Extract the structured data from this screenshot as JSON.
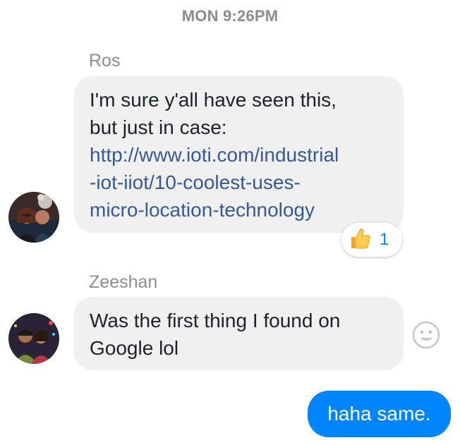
{
  "thread": {
    "timestamp": "MON 9:26PM"
  },
  "messages": [
    {
      "sender": "Ros",
      "text_lines": [
        "I'm sure y'all have seen this,",
        "but just in case:"
      ],
      "link_lines": [
        "http://www.ioti.com/industrial",
        "-iot-iiot/10-coolest-uses-",
        "micro-location-technology"
      ],
      "reaction": {
        "icon": "thumbs-up-icon",
        "count": "1",
        "count_color": "#0084ff"
      }
    },
    {
      "sender": "Zeeshan",
      "text_lines": [
        "Was the first thing I found on",
        "Google lol"
      ],
      "emoji_button_icon": "smiley-icon"
    },
    {
      "sender": "me",
      "text": "haha same."
    }
  ],
  "colors": {
    "incoming_bubble": "#f1f0f0",
    "outgoing_bubble": "#0084ff",
    "link": "#365899",
    "meta_text": "#8a8d91"
  }
}
